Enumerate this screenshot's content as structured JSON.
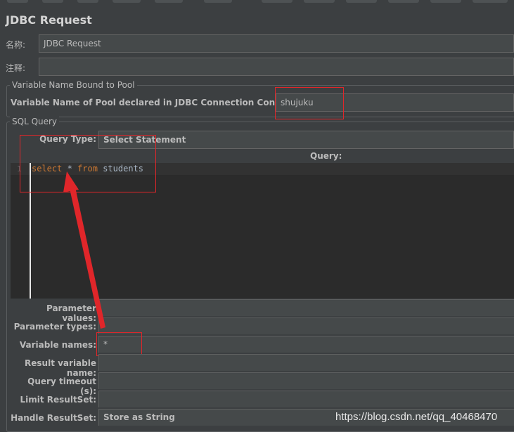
{
  "header": {
    "title": "JDBC Request"
  },
  "name_row": {
    "label": "名称:",
    "value": "JDBC Request"
  },
  "comment_row": {
    "label": "注释:",
    "value": ""
  },
  "pool_group": {
    "title": "Variable Name Bound to Pool",
    "label": "Variable Name of Pool declared in JDBC Connection Configuration:",
    "value": "shujuku"
  },
  "sql_group": {
    "title": "SQL Query",
    "query_type_label": "Query Type:",
    "query_type_value": "Select Statement",
    "query_header": "Query:",
    "editor": {
      "line_number": "1",
      "tokens": {
        "select": "select",
        "star": "*",
        "from": "from",
        "table": "students"
      }
    }
  },
  "params": {
    "parameter_values": {
      "label": "Parameter values:",
      "value": ""
    },
    "parameter_types": {
      "label": "Parameter types:",
      "value": ""
    },
    "variable_names": {
      "label": "Variable names:",
      "value": "*"
    },
    "result_variable_name": {
      "label": "Result variable name:",
      "value": ""
    },
    "query_timeout": {
      "label": "Query timeout (s):",
      "value": ""
    },
    "limit_resultset": {
      "label": "Limit ResultSet:",
      "value": ""
    },
    "handle_resultset": {
      "label": "Handle ResultSet:",
      "value": "Store as String"
    }
  },
  "watermark": "https://blog.csdn.net/qq_40468470",
  "colors": {
    "background": "#3c3f41",
    "editor_background": "#2b2b2b",
    "keyword": "#cc7832",
    "annotation_red": "#e0262a"
  }
}
